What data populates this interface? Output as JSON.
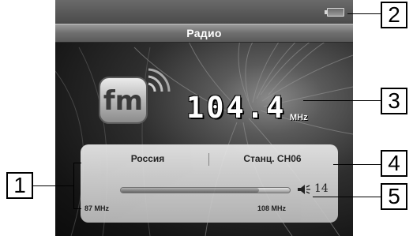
{
  "screen": {
    "title": "Радио",
    "frequency": "104.4",
    "frequency_unit": "MHz",
    "logo_icon": "fm-logo-icon",
    "region": "Россия",
    "station": "Станц. CH06",
    "band_min": "87 MHz",
    "band_max": "108 MHz",
    "volume": "14",
    "tuner_position_fraction": 0.82
  },
  "callouts": [
    "1",
    "2",
    "3",
    "4",
    "5"
  ],
  "colors": {
    "frame_bg": "#ffffff",
    "screen_dark": "#141414",
    "panel_light": "#d6d6d6",
    "callout_border": "#000000"
  }
}
